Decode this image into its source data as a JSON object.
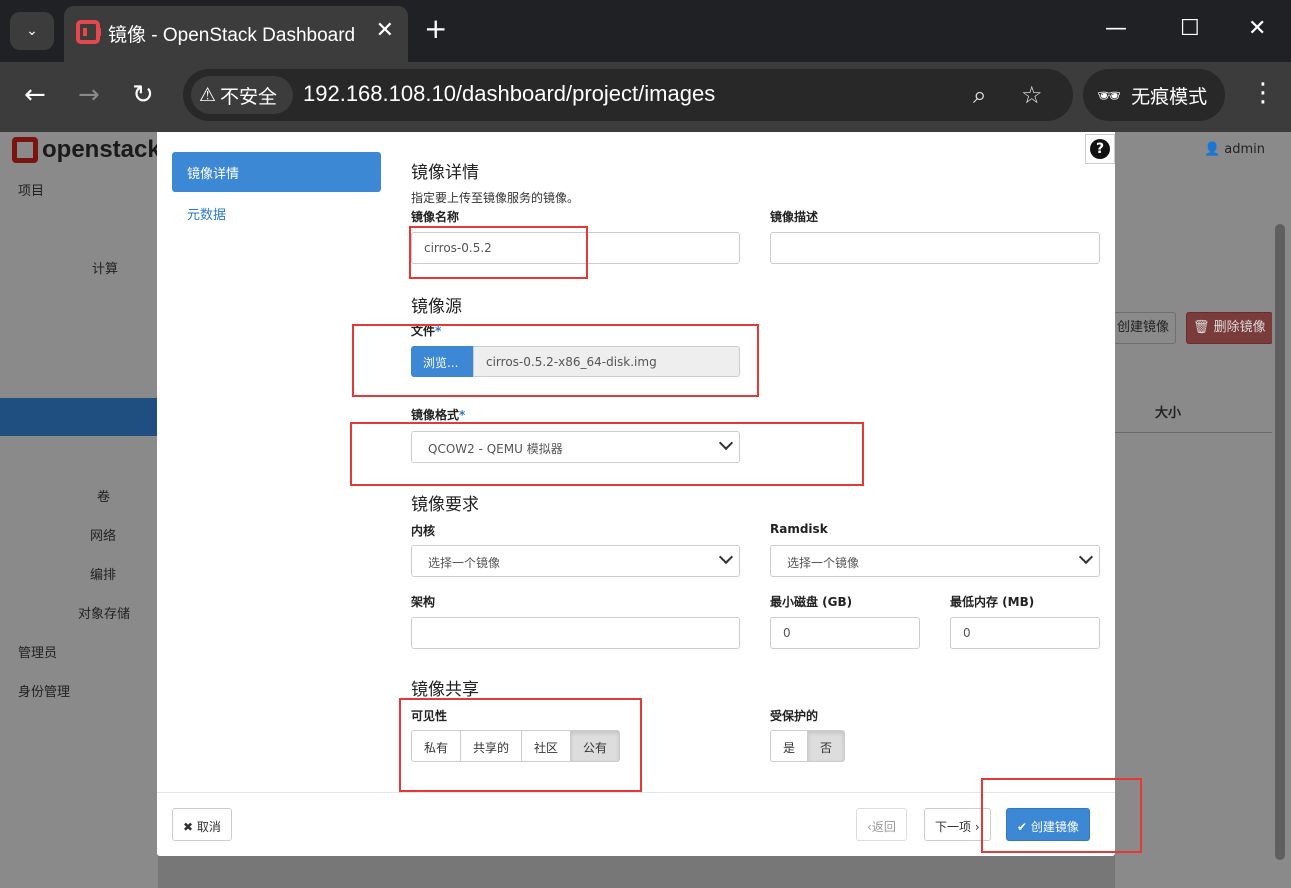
{
  "browser": {
    "tab_title": "镜像 - OpenStack Dashboard",
    "security_label": "不安全",
    "url": "192.168.108.10/dashboard/project/images",
    "incognito_label": "无痕模式"
  },
  "header": {
    "logo_text": "openstack.",
    "user": "admin"
  },
  "sidebar": {
    "items": [
      "项目",
      "计算",
      "卷",
      "网络",
      "编排",
      "对象存储",
      "管理员",
      "身份管理"
    ]
  },
  "background": {
    "create_button": "创建镜像",
    "delete_button": "删除镜像",
    "size_header": "大小"
  },
  "modal": {
    "tabs": [
      "镜像详情",
      "元数据"
    ],
    "section_details": "镜像详情",
    "details_desc": "指定要上传至镜像服务的镜像。",
    "name_label": "镜像名称",
    "name_value": "cirros-0.5.2",
    "desc_label": "镜像描述",
    "desc_value": "",
    "section_source": "镜像源",
    "file_label": "文件",
    "browse_label": "浏览...",
    "file_value": "cirros-0.5.2-x86_64-disk.img",
    "format_label": "镜像格式",
    "format_value": "QCOW2 - QEMU 模拟器",
    "section_requirements": "镜像要求",
    "kernel_label": "内核",
    "kernel_value": "选择一个镜像",
    "ramdisk_label": "Ramdisk",
    "ramdisk_value": "选择一个镜像",
    "arch_label": "架构",
    "arch_value": "",
    "min_disk_label": "最小磁盘 (GB)",
    "min_disk_value": "0",
    "min_ram_label": "最低内存 (MB)",
    "min_ram_value": "0",
    "section_sharing": "镜像共享",
    "visibility_label": "可见性",
    "visibility_options": [
      "私有",
      "共享的",
      "社区",
      "公有"
    ],
    "visibility_selected": "公有",
    "protected_label": "受保护的",
    "protected_options": [
      "是",
      "否"
    ],
    "protected_selected": "否",
    "cancel_label": "取消",
    "back_label": "返回",
    "next_label": "下一项",
    "create_label": "创建镜像"
  },
  "colors": {
    "primary": "#3d88d4",
    "highlight": "#e53935"
  }
}
